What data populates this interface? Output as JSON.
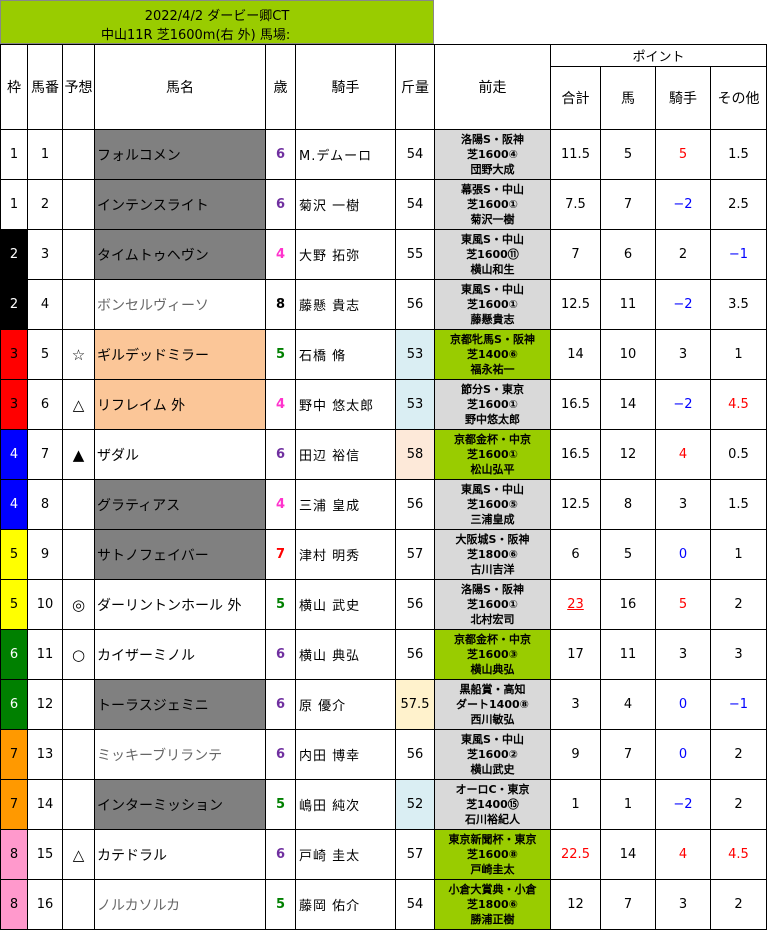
{
  "header": {
    "line1": "2022/4/2 ダービー卿CT",
    "line2": "中山11R  芝1600m(右 外)  馬場:"
  },
  "columns": {
    "waku": "枠",
    "umaban": "馬番",
    "yoso": "予想",
    "horse": "馬名",
    "age": "歳",
    "jockey": "騎手",
    "weight": "斤量",
    "prev": "前走",
    "points": "ポイント",
    "total": "合計",
    "uma": "馬",
    "kishu": "騎手",
    "other": "その他"
  },
  "rows": [
    {
      "waku": "1",
      "umaban": "1",
      "mark": "",
      "horse": "フォルコメン",
      "age": "6",
      "jockey": "M.デムーロ",
      "weight": "54",
      "prev": [
        "洛陽S・阪神",
        "芝1600④",
        "団野大成"
      ],
      "total": "11.5",
      "uma": "5",
      "kishu": "5",
      "other": "1.5"
    },
    {
      "waku": "1",
      "umaban": "2",
      "mark": "",
      "horse": "インテンスライト",
      "age": "6",
      "jockey": "菊沢 一樹",
      "weight": "54",
      "prev": [
        "幕張S・中山",
        "芝1600①",
        "菊沢一樹"
      ],
      "total": "7.5",
      "uma": "7",
      "kishu": "−2",
      "other": "2.5"
    },
    {
      "waku": "2",
      "umaban": "3",
      "mark": "",
      "horse": "タイムトゥヘヴン",
      "age": "4",
      "jockey": "大野 拓弥",
      "weight": "55",
      "prev": [
        "東風S・中山",
        "芝1600⑪",
        "横山和生"
      ],
      "total": "7",
      "uma": "6",
      "kishu": "2",
      "other": "−1"
    },
    {
      "waku": "2",
      "umaban": "4",
      "mark": "",
      "horse": "ボンセルヴィーソ",
      "age": "8",
      "jockey": "藤懸 貴志",
      "weight": "56",
      "prev": [
        "東風S・中山",
        "芝1600①",
        "藤懸貴志"
      ],
      "total": "12.5",
      "uma": "11",
      "kishu": "−2",
      "other": "3.5"
    },
    {
      "waku": "3",
      "umaban": "5",
      "mark": "☆",
      "horse": "ギルデッドミラー",
      "age": "5",
      "jockey": "石橋 脩",
      "weight": "53",
      "prev": [
        "京都牝馬S・阪神",
        "芝1400⑥",
        "福永祐一"
      ],
      "total": "14",
      "uma": "10",
      "kishu": "3",
      "other": "1"
    },
    {
      "waku": "3",
      "umaban": "6",
      "mark": "△",
      "horse": "リフレイム 外",
      "age": "4",
      "jockey": "野中 悠太郎",
      "weight": "53",
      "prev": [
        "節分S・東京",
        "芝1600①",
        "野中悠太郎"
      ],
      "total": "16.5",
      "uma": "14",
      "kishu": "−2",
      "other": "4.5"
    },
    {
      "waku": "4",
      "umaban": "7",
      "mark": "▲",
      "horse": "ザダル",
      "age": "6",
      "jockey": "田辺 裕信",
      "weight": "58",
      "prev": [
        "京都金杯・中京",
        "芝1600①",
        "松山弘平"
      ],
      "total": "16.5",
      "uma": "12",
      "kishu": "4",
      "other": "0.5"
    },
    {
      "waku": "4",
      "umaban": "8",
      "mark": "",
      "horse": "グラティアス",
      "age": "4",
      "jockey": "三浦 皇成",
      "weight": "56",
      "prev": [
        "東風S・中山",
        "芝1600⑤",
        "三浦皇成"
      ],
      "total": "12.5",
      "uma": "8",
      "kishu": "3",
      "other": "1.5"
    },
    {
      "waku": "5",
      "umaban": "9",
      "mark": "",
      "horse": "サトノフェイバー",
      "age": "7",
      "jockey": "津村 明秀",
      "weight": "57",
      "prev": [
        "大阪城S・阪神",
        "芝1800⑥",
        "古川吉洋"
      ],
      "total": "6",
      "uma": "5",
      "kishu": "0",
      "other": "1"
    },
    {
      "waku": "5",
      "umaban": "10",
      "mark": "◎",
      "horse": "ダーリントンホール 外",
      "age": "5",
      "jockey": "横山 武史",
      "weight": "56",
      "prev": [
        "洛陽S・阪神",
        "芝1600①",
        "北村宏司"
      ],
      "total": "23",
      "uma": "16",
      "kishu": "5",
      "other": "2"
    },
    {
      "waku": "6",
      "umaban": "11",
      "mark": "○",
      "horse": "カイザーミノル",
      "age": "6",
      "jockey": "横山 典弘",
      "weight": "56",
      "prev": [
        "京都金杯・中京",
        "芝1600③",
        "横山典弘"
      ],
      "total": "17",
      "uma": "11",
      "kishu": "3",
      "other": "3"
    },
    {
      "waku": "6",
      "umaban": "12",
      "mark": "",
      "horse": "トーラスジェミニ",
      "age": "6",
      "jockey": "原 優介",
      "weight": "57.5",
      "prev": [
        "黒船賞・高知",
        "ダート1400⑧",
        "西川敏弘"
      ],
      "total": "3",
      "uma": "4",
      "kishu": "0",
      "other": "−1"
    },
    {
      "waku": "7",
      "umaban": "13",
      "mark": "",
      "horse": "ミッキーブリランテ",
      "age": "6",
      "jockey": "内田 博幸",
      "weight": "56",
      "prev": [
        "東風S・中山",
        "芝1600②",
        "横山武史"
      ],
      "total": "9",
      "uma": "7",
      "kishu": "0",
      "other": "2"
    },
    {
      "waku": "7",
      "umaban": "14",
      "mark": "",
      "horse": "インターミッション",
      "age": "5",
      "jockey": "嶋田 純次",
      "weight": "52",
      "prev": [
        "オーロC・東京",
        "芝1400⑮",
        "石川裕紀人"
      ],
      "total": "1",
      "uma": "1",
      "kishu": "−2",
      "other": "2"
    },
    {
      "waku": "8",
      "umaban": "15",
      "mark": "△",
      "horse": "カテドラル",
      "age": "6",
      "jockey": "戸崎 圭太",
      "weight": "57",
      "prev": [
        "東京新聞杯・東京",
        "芝1600⑧",
        "戸崎圭太"
      ],
      "total": "22.5",
      "uma": "14",
      "kishu": "4",
      "other": "4.5"
    },
    {
      "waku": "8",
      "umaban": "16",
      "mark": "",
      "horse": "ノルカソルカ",
      "age": "5",
      "jockey": "藤岡 佑介",
      "weight": "54",
      "prev": [
        "小倉大賞典・小倉",
        "芝1800⑥",
        "勝浦正樹"
      ],
      "total": "12",
      "uma": "7",
      "kishu": "3",
      "other": "2"
    }
  ],
  "styles": {
    "horse_bg": [
      "gray",
      "gray",
      "gray",
      "",
      "orange",
      "orange",
      "",
      "gray",
      "gray",
      "",
      "",
      "gray",
      "",
      "gray",
      "",
      ""
    ],
    "horse_color": [
      "black",
      "black",
      "black",
      "gray",
      "black",
      "black",
      "black",
      "black",
      "black",
      "black",
      "black",
      "black",
      "gray",
      "black",
      "black",
      "gray"
    ],
    "age_color": [
      "purple",
      "purple",
      "pink",
      "black",
      "green",
      "pink",
      "purple",
      "pink",
      "red",
      "green",
      "purple",
      "purple",
      "purple",
      "green",
      "purple",
      "green"
    ],
    "weight_bg": [
      "",
      "",
      "",
      "",
      "wblue",
      "wblue",
      "wpink",
      "",
      "",
      "",
      "",
      "wyellow",
      "",
      "wblue",
      "",
      ""
    ],
    "prev_bg": [
      "gray",
      "gray",
      "gray",
      "gray",
      "green",
      "gray",
      "green",
      "gray",
      "gray",
      "gray",
      "green",
      "gray",
      "gray",
      "gray",
      "green",
      "green"
    ],
    "total_color": [
      "black",
      "black",
      "black",
      "black",
      "black",
      "black",
      "black",
      "black",
      "black",
      "red-u",
      "black",
      "black",
      "black",
      "black",
      "red",
      "black"
    ],
    "kishu_color": [
      "red",
      "blue",
      "black",
      "blue",
      "black",
      "blue",
      "red",
      "black",
      "blue",
      "red",
      "black",
      "blue",
      "blue",
      "blue",
      "red",
      "black"
    ],
    "other_color": [
      "black",
      "black",
      "blue",
      "black",
      "black",
      "red",
      "black",
      "black",
      "black",
      "black",
      "black",
      "blue",
      "black",
      "black",
      "red",
      "black"
    ]
  }
}
